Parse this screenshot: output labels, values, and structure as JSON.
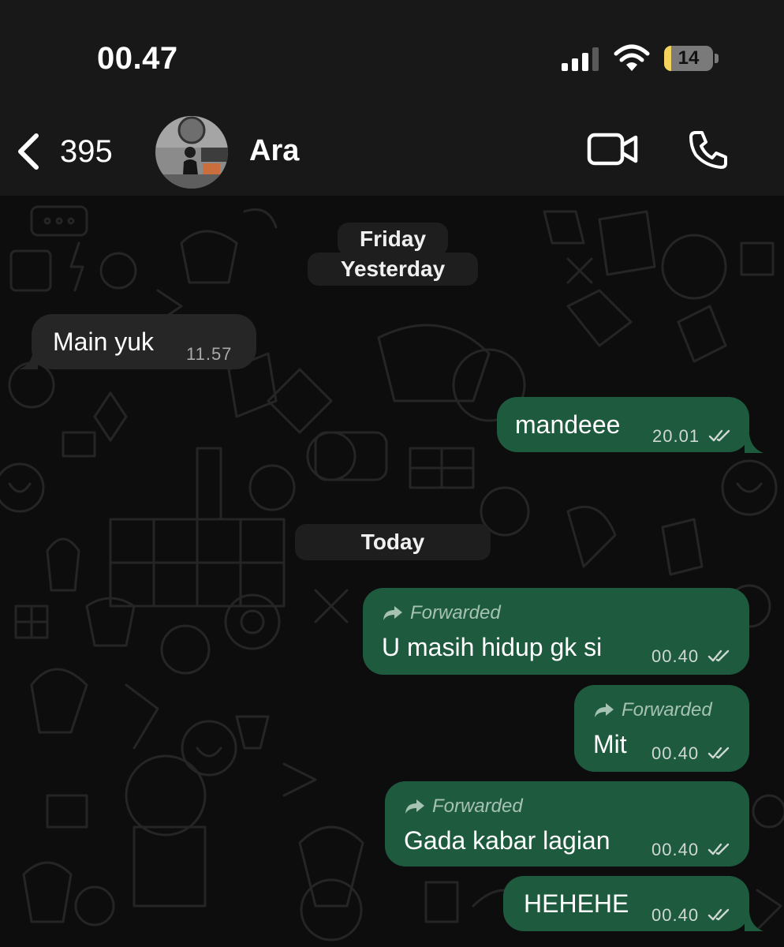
{
  "status_bar": {
    "time": "00.47",
    "battery_level": "14",
    "battery_fraction": 0.14,
    "battery_color": "#f3d35b",
    "icons": [
      "signal-icon",
      "wifi-icon",
      "battery-icon"
    ]
  },
  "header": {
    "back_count": "395",
    "contact_name": "Ara",
    "icons": [
      "back-chevron-icon",
      "video-call-icon",
      "phone-call-icon"
    ]
  },
  "chat": {
    "date_chips": {
      "friday": "Friday",
      "yesterday": "Yesterday",
      "today": "Today"
    },
    "forwarded_label": "Forwarded",
    "messages": [
      {
        "direction": "incoming",
        "text": "Main yuk",
        "time": "11.57",
        "forwarded": false
      },
      {
        "direction": "outgoing",
        "text": "mandeee",
        "time": "20.01",
        "forwarded": false,
        "status": "read"
      },
      {
        "direction": "outgoing",
        "text": "U masih hidup gk si",
        "time": "00.40",
        "forwarded": true,
        "status": "read"
      },
      {
        "direction": "outgoing",
        "text": "Mit",
        "time": "00.40",
        "forwarded": true,
        "status": "read"
      },
      {
        "direction": "outgoing",
        "text": "Gada kabar lagian",
        "time": "00.40",
        "forwarded": true,
        "status": "read"
      },
      {
        "direction": "outgoing",
        "text": "HEHEHE",
        "time": "00.40",
        "forwarded": false,
        "status": "read"
      }
    ]
  },
  "colors": {
    "outgoing_bubble": "#1d5a3e",
    "incoming_bubble": "#262626",
    "header_bg": "#181818",
    "chat_bg": "#0d0d0d"
  }
}
